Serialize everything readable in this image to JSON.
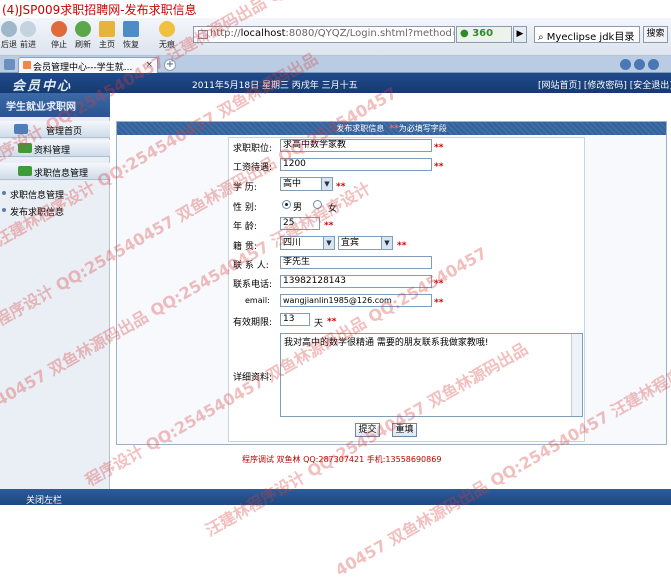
{
  "caption": "(4)JSP009求职招聘网-发布求职信息",
  "browser": {
    "toolbar": {
      "back": "后退",
      "forward": "前进",
      "stop": "停止",
      "refresh": "刷新",
      "home": "主页",
      "restore": "恢复",
      "no_image": "无痕"
    },
    "address": {
      "prefix": "http://",
      "host": "localhost",
      "rest": ":8080/QYQZ/Login.shtml?method=PAGE"
    },
    "brand": "360",
    "search_text": "Myeclipse jdk目录",
    "search_button": "搜索",
    "tab_title": "会员管理中心---学生就...",
    "tab_close": "×",
    "new_tab": "+"
  },
  "site": {
    "logo": "会员中心",
    "date": "2011年5月18日 星期三 丙戌年 三月十五",
    "links": "[网站首页] [修改密码] [安全退出]",
    "subtitle": "学生就业求职网"
  },
  "sidebar": {
    "sections": [
      {
        "label": "管理首页"
      },
      {
        "label": "资料管理"
      },
      {
        "label": "求职信息管理"
      }
    ],
    "items": [
      {
        "label": "求职信息管理"
      },
      {
        "label": "发布求职信息"
      }
    ],
    "close_label": "关闭左栏"
  },
  "form": {
    "title": "发布求职信息",
    "title_note": "为必填写字段",
    "required_mark": "**",
    "fields": {
      "position": {
        "label": "求职职位:",
        "value": "求高中数学家教"
      },
      "salary": {
        "label": "工资待遇:",
        "value": "1200"
      },
      "education": {
        "label": "学    历:",
        "value": "高中"
      },
      "gender": {
        "label": "性    别:",
        "male": "男",
        "female": "女",
        "selected": "男"
      },
      "age": {
        "label": "年    龄:",
        "value": "25"
      },
      "native": {
        "label": "籍    贯:",
        "province": "四川",
        "city": "宜宾"
      },
      "contact": {
        "label": "联 系 人:",
        "value": "李先生"
      },
      "phone": {
        "label": "联系电话:",
        "value": "13982128143"
      },
      "email": {
        "label": "email:",
        "value": "wangjianlin1985@126.com"
      },
      "valid_days": {
        "label": "有效期限:",
        "value": "13",
        "unit": "天"
      },
      "details": {
        "label": "详细资料:",
        "value": "我对高中的数学很精通 需要的朋友联系我做家教哦!"
      }
    },
    "submit": "提交",
    "reset": "重填"
  },
  "footer": "程序调试 双鱼林 QQ:287307421 手机:13558690869",
  "watermark": {
    "lines": [
      "程序设计 QQ:254540457 汪建林源码出品 QQ:254540457",
      "汪建林程序设计 QQ:254540457 双鱼林源码出品",
      "程序设计 QQ:254540457 双鱼林源码出品 QQ:254540457",
      "40457 双鱼林源码出品 QQ:254540457 汪建林程序设计",
      "程序设计 QQ:254540457 双鱼林源码出品 QQ:254540457",
      "汪建林程序设计 QQ:254540457 双鱼林源码出品",
      "40457 双鱼林源码出品 QQ:254540457 汪建林程序设计"
    ]
  }
}
